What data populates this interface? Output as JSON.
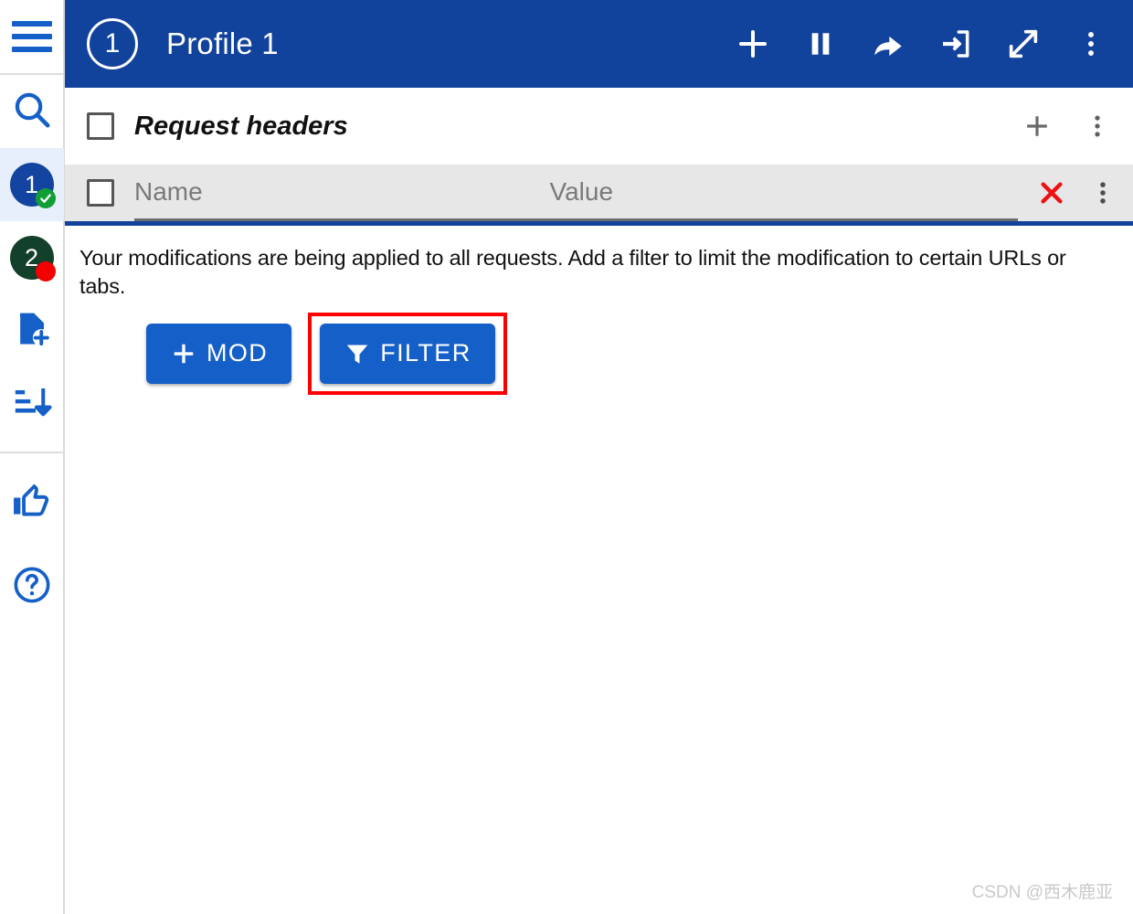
{
  "sidebar": {
    "items": [
      {
        "name": "menu",
        "icon": "hamburger-icon",
        "label": ""
      },
      {
        "name": "search",
        "icon": "search-icon",
        "label": ""
      },
      {
        "name": "profile-1",
        "icon": "profile-badge-icon",
        "label": "1",
        "badge": "check",
        "selected": true,
        "circle_color": "#1344a0",
        "badge_color": "#119e34"
      },
      {
        "name": "profile-2",
        "icon": "profile-badge-icon",
        "label": "2",
        "badge": "dot",
        "selected": false,
        "circle_color": "#13402a",
        "badge_color": "#f40000"
      },
      {
        "name": "new-profile",
        "icon": "file-add-icon",
        "label": ""
      },
      {
        "name": "sort",
        "icon": "sort-descending-icon",
        "label": ""
      },
      {
        "name": "rate",
        "icon": "thumbs-up-icon",
        "label": ""
      },
      {
        "name": "help",
        "icon": "help-circle-icon",
        "label": ""
      }
    ]
  },
  "appbar": {
    "profile_number": "1",
    "title": "Profile 1",
    "background": "#12439c",
    "actions": [
      {
        "name": "add-profile-button",
        "icon": "plus-icon",
        "label": "Add"
      },
      {
        "name": "pause-button",
        "icon": "pause-icon",
        "label": "Pause"
      },
      {
        "name": "share-button",
        "icon": "share-arrow-icon",
        "label": "Share"
      },
      {
        "name": "import-button",
        "icon": "import-icon",
        "label": "Import"
      },
      {
        "name": "expand-button",
        "icon": "expand-diagonal-icon",
        "label": "Expand"
      },
      {
        "name": "overflow-menu-button",
        "icon": "kebab-menu-icon",
        "label": "More"
      }
    ]
  },
  "section": {
    "checkbox_checked": false,
    "title": "Request headers",
    "add_label": "Add",
    "menu_label": "More"
  },
  "header_row": {
    "checkbox_checked": false,
    "name_placeholder": "Name",
    "name_value": "",
    "value_placeholder": "Value",
    "value_value": "",
    "delete_label": "Remove",
    "menu_label": "More",
    "background": "#e7e7e7",
    "rule_color": "#12439c"
  },
  "body": {
    "description": "Your modifications are being applied to all requests. Add a filter to limit the modification to certain URLs or tabs.",
    "buttons": [
      {
        "name": "add-mod-button",
        "icon": "plus-icon",
        "label": "MOD",
        "highlighted": false
      },
      {
        "name": "add-filter-button",
        "icon": "funnel-icon",
        "label": "FILTER",
        "highlighted": true
      }
    ],
    "button_color": "#1560c8",
    "highlight_color": "#ff0000"
  },
  "watermark": {
    "text": "CSDN @西木鹿亚"
  }
}
